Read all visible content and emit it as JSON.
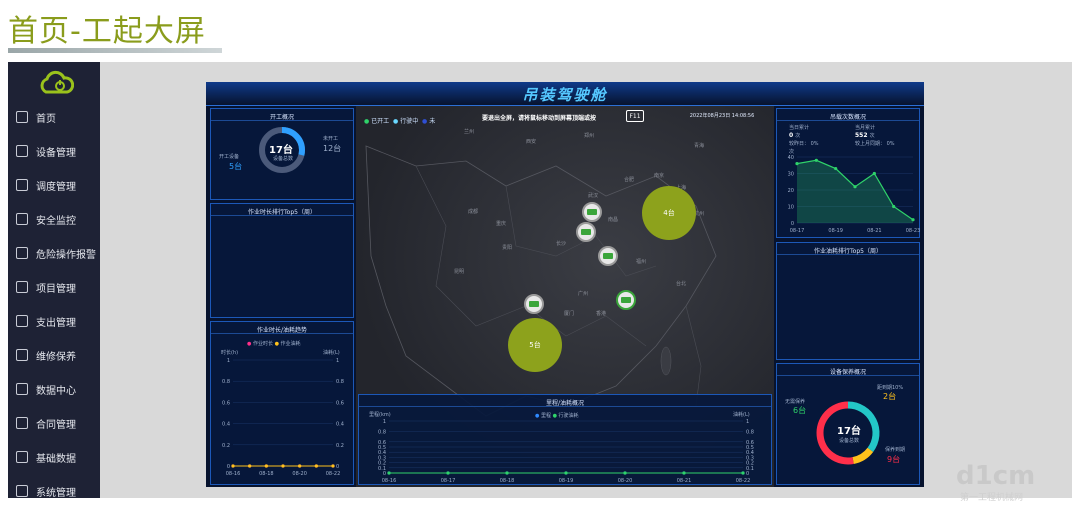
{
  "slide": {
    "title": "首页-工起大屏"
  },
  "sidebar": {
    "items": [
      {
        "label": "首页",
        "icon": "home-icon"
      },
      {
        "label": "设备管理",
        "icon": "gear-icon"
      },
      {
        "label": "调度管理",
        "icon": "dispatch-icon"
      },
      {
        "label": "安全监控",
        "icon": "camera-icon"
      },
      {
        "label": "危险操作报警",
        "icon": "alarm-icon"
      },
      {
        "label": "项目管理",
        "icon": "folder-icon"
      },
      {
        "label": "支出管理",
        "icon": "expense-icon"
      },
      {
        "label": "维修保养",
        "icon": "shield-icon"
      },
      {
        "label": "数据中心",
        "icon": "data-icon"
      },
      {
        "label": "合同管理",
        "icon": "contract-icon"
      },
      {
        "label": "基础数据",
        "icon": "cart-icon"
      },
      {
        "label": "系统管理",
        "icon": "org-icon"
      }
    ]
  },
  "dashboard": {
    "title": "吊装驾驶舱",
    "notice": "要退出全屏，请将鼠标移动到屏幕顶端或按",
    "f11": "F11",
    "datetime": "2022年08月23日 14:08:56",
    "map_legend": [
      "已开工",
      "行驶中",
      "未"
    ],
    "cities": [
      "兰州",
      "西安",
      "郑州",
      "青海",
      "合肥",
      "南京",
      "上海",
      "武汉",
      "成都",
      "重庆",
      "南昌",
      "杭州",
      "贵阳",
      "长沙",
      "福州",
      "昆明",
      "台北",
      "广州",
      "厦门",
      "香港"
    ],
    "bubbles": [
      "4台",
      "5台"
    ]
  },
  "work_status": {
    "title": "开工概况",
    "started_label": "开工设备",
    "started_value": "5台",
    "idle_label": "未开工",
    "idle_value": "12台",
    "total_value": "17台",
    "total_label": "设备总数",
    "started_fraction": 0.29
  },
  "work_duration_top5": {
    "title": "作业时长排行Top5（周）"
  },
  "duration_fuel": {
    "title": "作业时长/油耗趋势",
    "legend": [
      "作业时长",
      "作业油耗"
    ],
    "left_unit": "时长(h)",
    "right_unit": "油耗(L)"
  },
  "mileage_fuel": {
    "title": "里程/油耗概况",
    "legend": [
      "里程",
      "行驶油耗"
    ],
    "left_unit": "里程(km)",
    "right_unit": "油耗(L)"
  },
  "lift_count": {
    "title": "吊载次数概况",
    "today_label": "当日累计",
    "today_value": "0",
    "today_unit": "次",
    "today_cmp": "较昨日：",
    "today_cmp_val": "0%",
    "month_label": "当月累计",
    "month_value": "552",
    "month_unit": "次",
    "month_cmp": "较上月同期：",
    "month_cmp_val": "0%",
    "y_unit": "次"
  },
  "fuel_top5": {
    "title": "作业油耗排行Top5（周）"
  },
  "maintenance": {
    "title": "设备保养概况",
    "total_value": "17台",
    "total_label": "设备总数",
    "none_label": "无需保养",
    "none_value": "6台",
    "near_label": "距到期10%",
    "near_value": "2台",
    "due_label": "保养到期",
    "due_value": "9台"
  },
  "chart_data": [
    {
      "type": "line",
      "title": "作业时长/油耗趋势",
      "x": [
        "08-16",
        "08-18",
        "08-20",
        "08-22"
      ],
      "series": [
        {
          "name": "作业时长",
          "values": [
            0,
            0,
            0,
            0,
            0,
            0,
            0
          ]
        },
        {
          "name": "作业油耗",
          "values": [
            0,
            0,
            0,
            0,
            0,
            0,
            0
          ]
        }
      ],
      "yticks": [
        "0",
        "0.2",
        "0.4",
        "0.6",
        "0.8",
        "1"
      ],
      "ylim": [
        0,
        1
      ]
    },
    {
      "type": "line",
      "title": "里程/油耗概况",
      "x": [
        "08-16",
        "08-17",
        "08-18",
        "08-19",
        "08-20",
        "08-21",
        "08-22"
      ],
      "series": [
        {
          "name": "里程",
          "values": [
            0,
            0,
            0,
            0,
            0,
            0,
            0
          ]
        },
        {
          "name": "行驶油耗",
          "values": [
            0,
            0,
            0,
            0,
            0,
            0,
            0
          ]
        }
      ],
      "yticks": [
        "0",
        "0.1",
        "0.2",
        "0.3",
        "0.4",
        "0.5",
        "0.6",
        "0.8",
        "1"
      ],
      "ylim": [
        0,
        1
      ]
    },
    {
      "type": "area",
      "title": "吊载次数概况",
      "x": [
        "08-17",
        "08-19",
        "08-21",
        "08-23"
      ],
      "values": [
        36,
        38,
        33,
        22,
        30,
        10,
        2
      ],
      "yticks": [
        "0",
        "10",
        "20",
        "30",
        "40"
      ],
      "ylim": [
        0,
        40
      ]
    },
    {
      "type": "pie",
      "title": "设备保养概况",
      "categories": [
        "无需保养",
        "距到期10%",
        "保养到期"
      ],
      "values": [
        6,
        2,
        9
      ]
    }
  ]
}
